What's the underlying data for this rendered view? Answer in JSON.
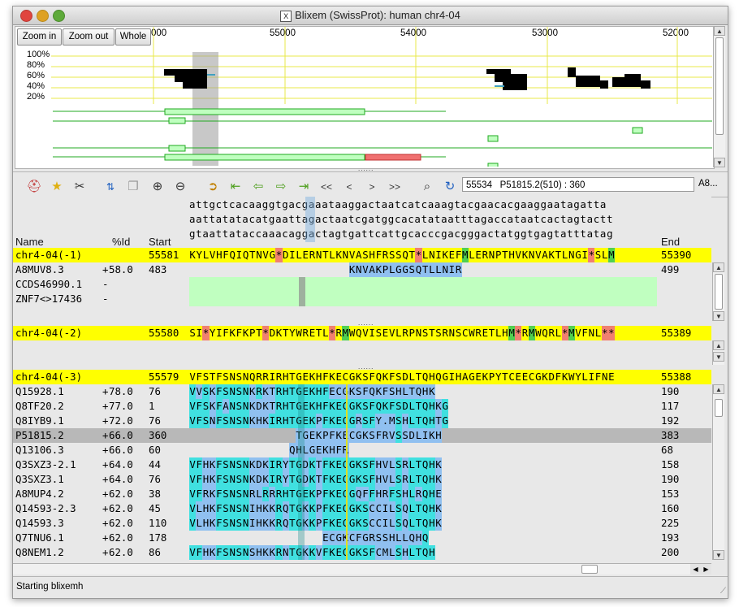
{
  "window": {
    "title": "Blixem (SwissProt):   human chr4-04"
  },
  "zoom": {
    "zoom_in": "Zoom in",
    "zoom_out": "Zoom out",
    "whole": "Whole"
  },
  "coverage": {
    "scale_ticks": [
      "000",
      "55000",
      "54000",
      "53000",
      "52000"
    ],
    "pct_labels": [
      "100%",
      "80%",
      "60%",
      "40%",
      "20%"
    ]
  },
  "toolbar": {
    "icons": [
      "help-icon",
      "favorite-icon",
      "settings-icon",
      "sort-icon",
      "copy-icon",
      "zoom-in-icon",
      "zoom-out-icon",
      "goto-icon",
      "first-match-icon",
      "prev-match-icon",
      "next-match-icon",
      "last-match-icon",
      "find-icon",
      "refresh-icon"
    ],
    "nav": [
      "<<",
      "<",
      ">",
      ">>"
    ],
    "feedback": "55534   P51815.2(510) : 360",
    "trailing": "A8..."
  },
  "dna": {
    "line1": "attgctcacaaggtgacgaaataaggactaatcatcaaagtacgaacacgaaggaatagatta",
    "line2": "aattatatacatgaattagactaatcgatggcacatataatttagaccataatcactagtactt",
    "line3": "gtaattataccaaacaggactagtgattcattgcacccgacgggactatggtgagtatttatag"
  },
  "columns": {
    "name": "Name",
    "pid": "%Id",
    "start": "Start",
    "end": "End"
  },
  "frame1": {
    "ref": {
      "name": "chr4-04(-1)",
      "start": "55581",
      "seq": "KYLVHFQIQTNVG*DILERNTLKNVASHFRSSQT*LNIKEFMLERNPTHVKNVAKTLNGI*SLM",
      "end": "55390"
    },
    "rows": [
      {
        "name": "A8MUV8.3",
        "strand": "+",
        "pid": "58.0",
        "start": "483",
        "seq": "                        KNVAKPLGGSQTLLNIR",
        "end": "499"
      },
      {
        "name": "CCDS46990.1",
        "strand": "-",
        "pid": "",
        "start": "",
        "seq": "",
        "end": ""
      },
      {
        "name": "ZNF7<>17436",
        "strand": "-",
        "pid": "",
        "start": "",
        "seq": "",
        "end": ""
      }
    ]
  },
  "frame2": {
    "ref": {
      "name": "chr4-04(-2)",
      "start": "55580",
      "seq": "SI*YIFKFKPT*DKTYWRETL*RMWQVISEVLRPNSTSRNSCWRETLHM*RMWQRL*MVFNL**",
      "end": "55389"
    }
  },
  "frame3": {
    "ref": {
      "name": "chr4-04(-3)",
      "start": "55579",
      "seq": "VFSTFSNSNQRRIRHTGEKHFKECGKSFQKFSDLTQHQGIHAGEKPYTCEECGKDFKWYLIFNE",
      "end": "55388"
    },
    "rows": [
      {
        "name": "Q15928.1",
        "strand": "+",
        "pid": "78.0",
        "start": "76",
        "seq": "VVSKFSNSNKRKTRHTGEKHFECGKSFQKFSHLTQHK",
        "end": "190"
      },
      {
        "name": "Q8TF20.2",
        "strand": "+",
        "pid": "77.0",
        "start": "1",
        "seq": "VFSKFANSNKDKTRHTGEKHFKECGKSFQKFSDLTQHKG",
        "end": "117"
      },
      {
        "name": "Q8IYB9.1",
        "strand": "+",
        "pid": "72.0",
        "start": "76",
        "seq": "VFSNFSNSNKHKIRHTGEKPFKECGRSFY.MSHLTQHTG",
        "end": "192"
      },
      {
        "name": "P51815.2",
        "strand": "+",
        "pid": "66.0",
        "start": "360",
        "seq": "                TGEKPFKECGKSFRVSSDLIKH",
        "end": "383"
      },
      {
        "name": "Q13106.3",
        "strand": "+",
        "pid": "66.0",
        "start": "60",
        "seq": "               QHLGEKHFR",
        "end": "68"
      },
      {
        "name": "Q3SXZ3-2.1",
        "strand": "+",
        "pid": "64.0",
        "start": "44",
        "seq": "VFHKFSNSNKDKIRYTGDKTFKECGKSFHVLSRLTQHK",
        "end": "158"
      },
      {
        "name": "Q3SXZ3.1",
        "strand": "+",
        "pid": "64.0",
        "start": "76",
        "seq": "VFHKFSNSNKDKIRYTGDKTFKECGKSFHVLSRLTQHK",
        "end": "190"
      },
      {
        "name": "A8MUP4.2",
        "strand": "+",
        "pid": "62.0",
        "start": "38",
        "seq": "VFRKFSNSNRLRRRHTGEKPFKECGQFFHRFSHLRQHE",
        "end": "153"
      },
      {
        "name": "Q14593-2.3",
        "strand": "+",
        "pid": "62.0",
        "start": "45",
        "seq": "VLHKFSNSNIHKKRQTGKKPFKECGKSCCILSQLTQHK",
        "end": "160"
      },
      {
        "name": "Q14593.3",
        "strand": "+",
        "pid": "62.0",
        "start": "110",
        "seq": "VLHKFSNSNIHKKRQTGKKPFKECGKSCCILSQLTQHK",
        "end": "225"
      },
      {
        "name": "Q7TNU6.1",
        "strand": "+",
        "pid": "62.0",
        "start": "178",
        "seq": "                    ECGKCFGRSSHLLQHQ",
        "end": "193"
      },
      {
        "name": "Q8NEM1.2",
        "strand": "+",
        "pid": "62.0",
        "start": "86",
        "seq": "VFHKFSNSNSHKKRNTGKKVFKECGKSFCMLSHLTQH",
        "end": "200"
      }
    ]
  },
  "status": {
    "text": "Starting blixemh"
  }
}
